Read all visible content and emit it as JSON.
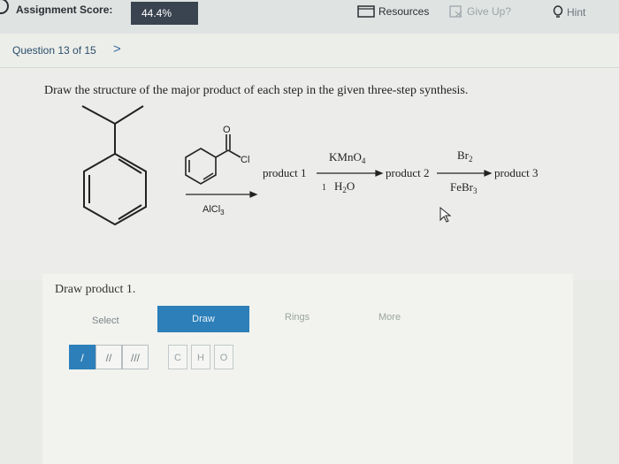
{
  "header": {
    "score_label": "Assignment Score:",
    "score_value": "44.4%",
    "resources_label": "Resources",
    "giveup_label": "Give Up?",
    "hint_label": "Hint"
  },
  "question": {
    "number_label": "Question 13 of 15",
    "next_glyph": ">"
  },
  "prompt": "Draw the structure of the major product of each step in the given three-step synthesis.",
  "scheme": {
    "acyl_cl": "Cl",
    "acyl_o": "O",
    "catalyst": "AlCl",
    "catalyst_sub": "3",
    "product1": "product 1",
    "reagent2_top": "KMnO",
    "reagent2_top_sub": "4",
    "reagent2_bottom": "H",
    "reagent2_bottom_sub": "2",
    "reagent2_bottom_end": "O",
    "product2": "product 2",
    "reagent3_top": "Br",
    "reagent3_top_sub": "2",
    "reagent3_bottom": "FeBr",
    "reagent3_bottom_sub": "3",
    "product3": "product 3"
  },
  "draw_panel": {
    "label": "Draw product 1.",
    "select_label": "Select",
    "draw_label": "Draw",
    "rings_label": "Rings",
    "more_label": "More",
    "bond_single": "/",
    "bond_double": "//",
    "bond_triple": "///",
    "atom_c": "C",
    "atom_h": "H",
    "atom_o": "O"
  }
}
